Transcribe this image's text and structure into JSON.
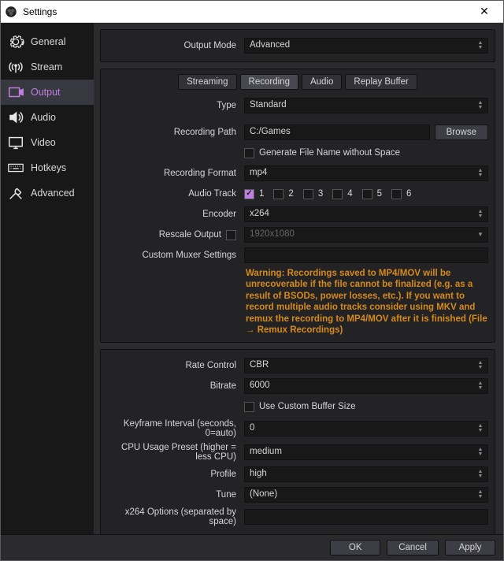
{
  "window": {
    "title": "Settings"
  },
  "sidebar": {
    "items": [
      {
        "label": "General"
      },
      {
        "label": "Stream"
      },
      {
        "label": "Output"
      },
      {
        "label": "Audio"
      },
      {
        "label": "Video"
      },
      {
        "label": "Hotkeys"
      },
      {
        "label": "Advanced"
      }
    ]
  },
  "output_mode": {
    "label": "Output Mode",
    "value": "Advanced"
  },
  "tabs": {
    "streaming": "Streaming",
    "recording": "Recording",
    "audio": "Audio",
    "replay": "Replay Buffer"
  },
  "recording": {
    "type_label": "Type",
    "type_value": "Standard",
    "path_label": "Recording Path",
    "path_value": "C:/Games",
    "browse": "Browse",
    "gen_filename": "Generate File Name without Space",
    "format_label": "Recording Format",
    "format_value": "mp4",
    "audio_track_label": "Audio Track",
    "tracks": [
      "1",
      "2",
      "3",
      "4",
      "5",
      "6"
    ],
    "encoder_label": "Encoder",
    "encoder_value": "x264",
    "rescale_label": "Rescale Output",
    "rescale_value": "1920x1080",
    "muxer_label": "Custom Muxer Settings",
    "warning": "Warning: Recordings saved to MP4/MOV will be unrecoverable if the file cannot be finalized (e.g. as a result of BSODs, power losses, etc.). If you want to record multiple audio tracks consider using MKV and remux the recording to MP4/MOV after it is finished (File → Remux Recordings)"
  },
  "encoder": {
    "rate_control_label": "Rate Control",
    "rate_control_value": "CBR",
    "bitrate_label": "Bitrate",
    "bitrate_value": "6000",
    "custom_buffer": "Use Custom Buffer Size",
    "keyframe_label": "Keyframe Interval (seconds, 0=auto)",
    "keyframe_value": "0",
    "cpu_label": "CPU Usage Preset (higher = less CPU)",
    "cpu_value": "medium",
    "profile_label": "Profile",
    "profile_value": "high",
    "tune_label": "Tune",
    "tune_value": "(None)",
    "x264opts_label": "x264 Options (separated by space)"
  },
  "footer": {
    "ok": "OK",
    "cancel": "Cancel",
    "apply": "Apply"
  }
}
